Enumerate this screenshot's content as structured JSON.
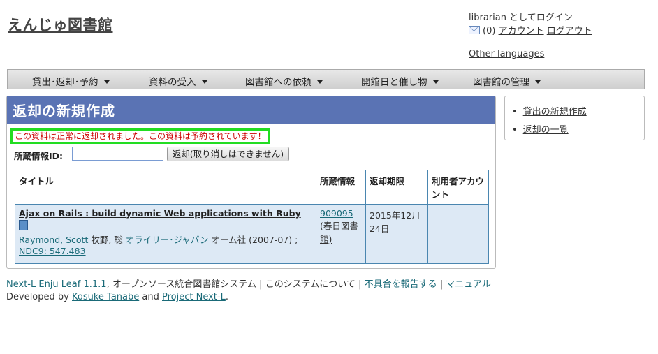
{
  "header": {
    "site_title": "えんじゅ図書館",
    "login_status": "librarian としてログイン",
    "mail_count": "(0)",
    "account_link": "アカウント",
    "logout_link": "ログアウト",
    "other_languages": "Other languages"
  },
  "nav": {
    "items": [
      {
        "label": "貸出･返却･予約"
      },
      {
        "label": "資料の受入"
      },
      {
        "label": "図書館への依頼"
      },
      {
        "label": "開館日と催し物"
      },
      {
        "label": "図書館の管理"
      }
    ]
  },
  "main": {
    "title": "返却の新規作成",
    "flash_message": "この資料は正常に返却されました。この資料は予約されています！",
    "item_id_label": "所蔵情報ID:",
    "item_id_value": "",
    "checkin_button": "返却(取り消しはできません)",
    "table": {
      "headers": [
        "タイトル",
        "所蔵情報",
        "返却期限",
        "利用者アカウント"
      ],
      "rows": [
        {
          "title": "Ajax on Rails : build dynamic Web applications with Ruby",
          "authors": [
            "Raymond, Scott",
            "牧野, 聡"
          ],
          "publishers": [
            "オライリー･ジャパン",
            "オーム社"
          ],
          "pub_date": "(2007-07)",
          "ndc": "NDC9: 547.483",
          "item_identifier": "909095",
          "library": "(春日図書館)",
          "due_date": "2015年12月24日",
          "user_account": ""
        }
      ]
    }
  },
  "sidebar": {
    "links": [
      "貸出の新規作成",
      "返却の一覧"
    ]
  },
  "footer": {
    "product": "Next-L Enju Leaf 1.1.1",
    "product_desc": ", オープンソース統合図書館システム",
    "about": "このシステムについて",
    "report": "不具合を報告する",
    "manual": "マニュアル",
    "developed_by": "Developed by",
    "developer": "Kosuke Tanabe",
    "and": "and",
    "project": "Project Next-L",
    "period": "."
  }
}
